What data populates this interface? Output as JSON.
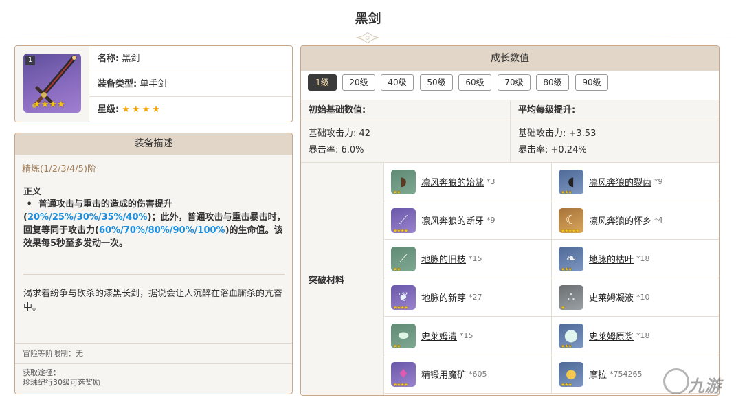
{
  "page": {
    "title": "黑剑"
  },
  "info": {
    "icon_level": "1",
    "icon_stars": "★★★★",
    "name_label": "名称:",
    "name_value": "黑剑",
    "type_label": "装备类型:",
    "type_value": "单手剑",
    "rarity_label": "星级:",
    "rarity_value": "★★★★"
  },
  "description": {
    "header": "装备描述",
    "refinement": "精炼(1/2/3/4/5)阶",
    "passive_name": "正义",
    "passive_bullet": "•",
    "passive_part1": "普通攻击与重击的造成的伤害提升(",
    "passive_val1": "20%/25%/30%/35%/40%",
    "passive_part2": ")；此外，普通攻击与重击暴击时，回复等同于攻击力(",
    "passive_val2": "60%/70%/80%/90%/100%",
    "passive_part3": ")的生命值。该效果每5秒至多发动一次。",
    "lore": "渴求着纷争与砍杀的漆黑长剑，据说会让人沉醉在浴血厮杀的亢奋中。",
    "limit": "冒险等阶限制：无",
    "source_label": "获取途径：",
    "source_value": "珍珠纪行30级可选奖励"
  },
  "growth": {
    "header": "成长数值",
    "levels": [
      "1级",
      "20级",
      "40级",
      "50级",
      "60级",
      "70级",
      "80级",
      "90级"
    ],
    "active_level": "1级",
    "base_header": "初始基础数值:",
    "per_level_header": "平均每级提升:",
    "base_atk": "基础攻击力: 42",
    "base_crit": "暴击率: 6.0%",
    "inc_atk": "基础攻击力: +3.53",
    "inc_crit": "暴击率: +0.24%",
    "materials_label": "突破材料",
    "materials": [
      {
        "name": "凛风奔狼的始龀",
        "count": "*3",
        "rarity": "★★",
        "icon": "fang-icon"
      },
      {
        "name": "凛风奔狼的裂齿",
        "count": "*9",
        "rarity": "★★★",
        "icon": "cracked-tooth-icon"
      },
      {
        "name": "凛风奔狼的断牙",
        "count": "*9",
        "rarity": "★★★★",
        "icon": "broken-fang-icon"
      },
      {
        "name": "凛风奔狼的怀乡",
        "count": "*4",
        "rarity": "★★★★★",
        "icon": "wolf-nostalgia-icon"
      },
      {
        "name": "地脉的旧枝",
        "count": "*15",
        "rarity": "★★",
        "icon": "old-branch-icon"
      },
      {
        "name": "地脉的枯叶",
        "count": "*18",
        "rarity": "★★★",
        "icon": "withered-leaf-icon"
      },
      {
        "name": "地脉的新芽",
        "count": "*27",
        "rarity": "★★★★",
        "icon": "new-sprout-icon"
      },
      {
        "name": "史莱姆凝液",
        "count": "*10",
        "rarity": "★",
        "icon": "slime-condensate-icon"
      },
      {
        "name": "史莱姆清",
        "count": "*15",
        "rarity": "★★",
        "icon": "slime-secretions-icon"
      },
      {
        "name": "史莱姆原浆",
        "count": "*18",
        "rarity": "★★★",
        "icon": "slime-concentrate-icon"
      },
      {
        "name": "精锻用魔矿",
        "count": "*605",
        "rarity": "★★★★",
        "icon": "ore-icon"
      },
      {
        "name": "摩拉",
        "count": "*754265",
        "rarity": "★★★",
        "icon": "mora-icon"
      }
    ]
  },
  "watermark": {
    "text": "九游"
  }
}
